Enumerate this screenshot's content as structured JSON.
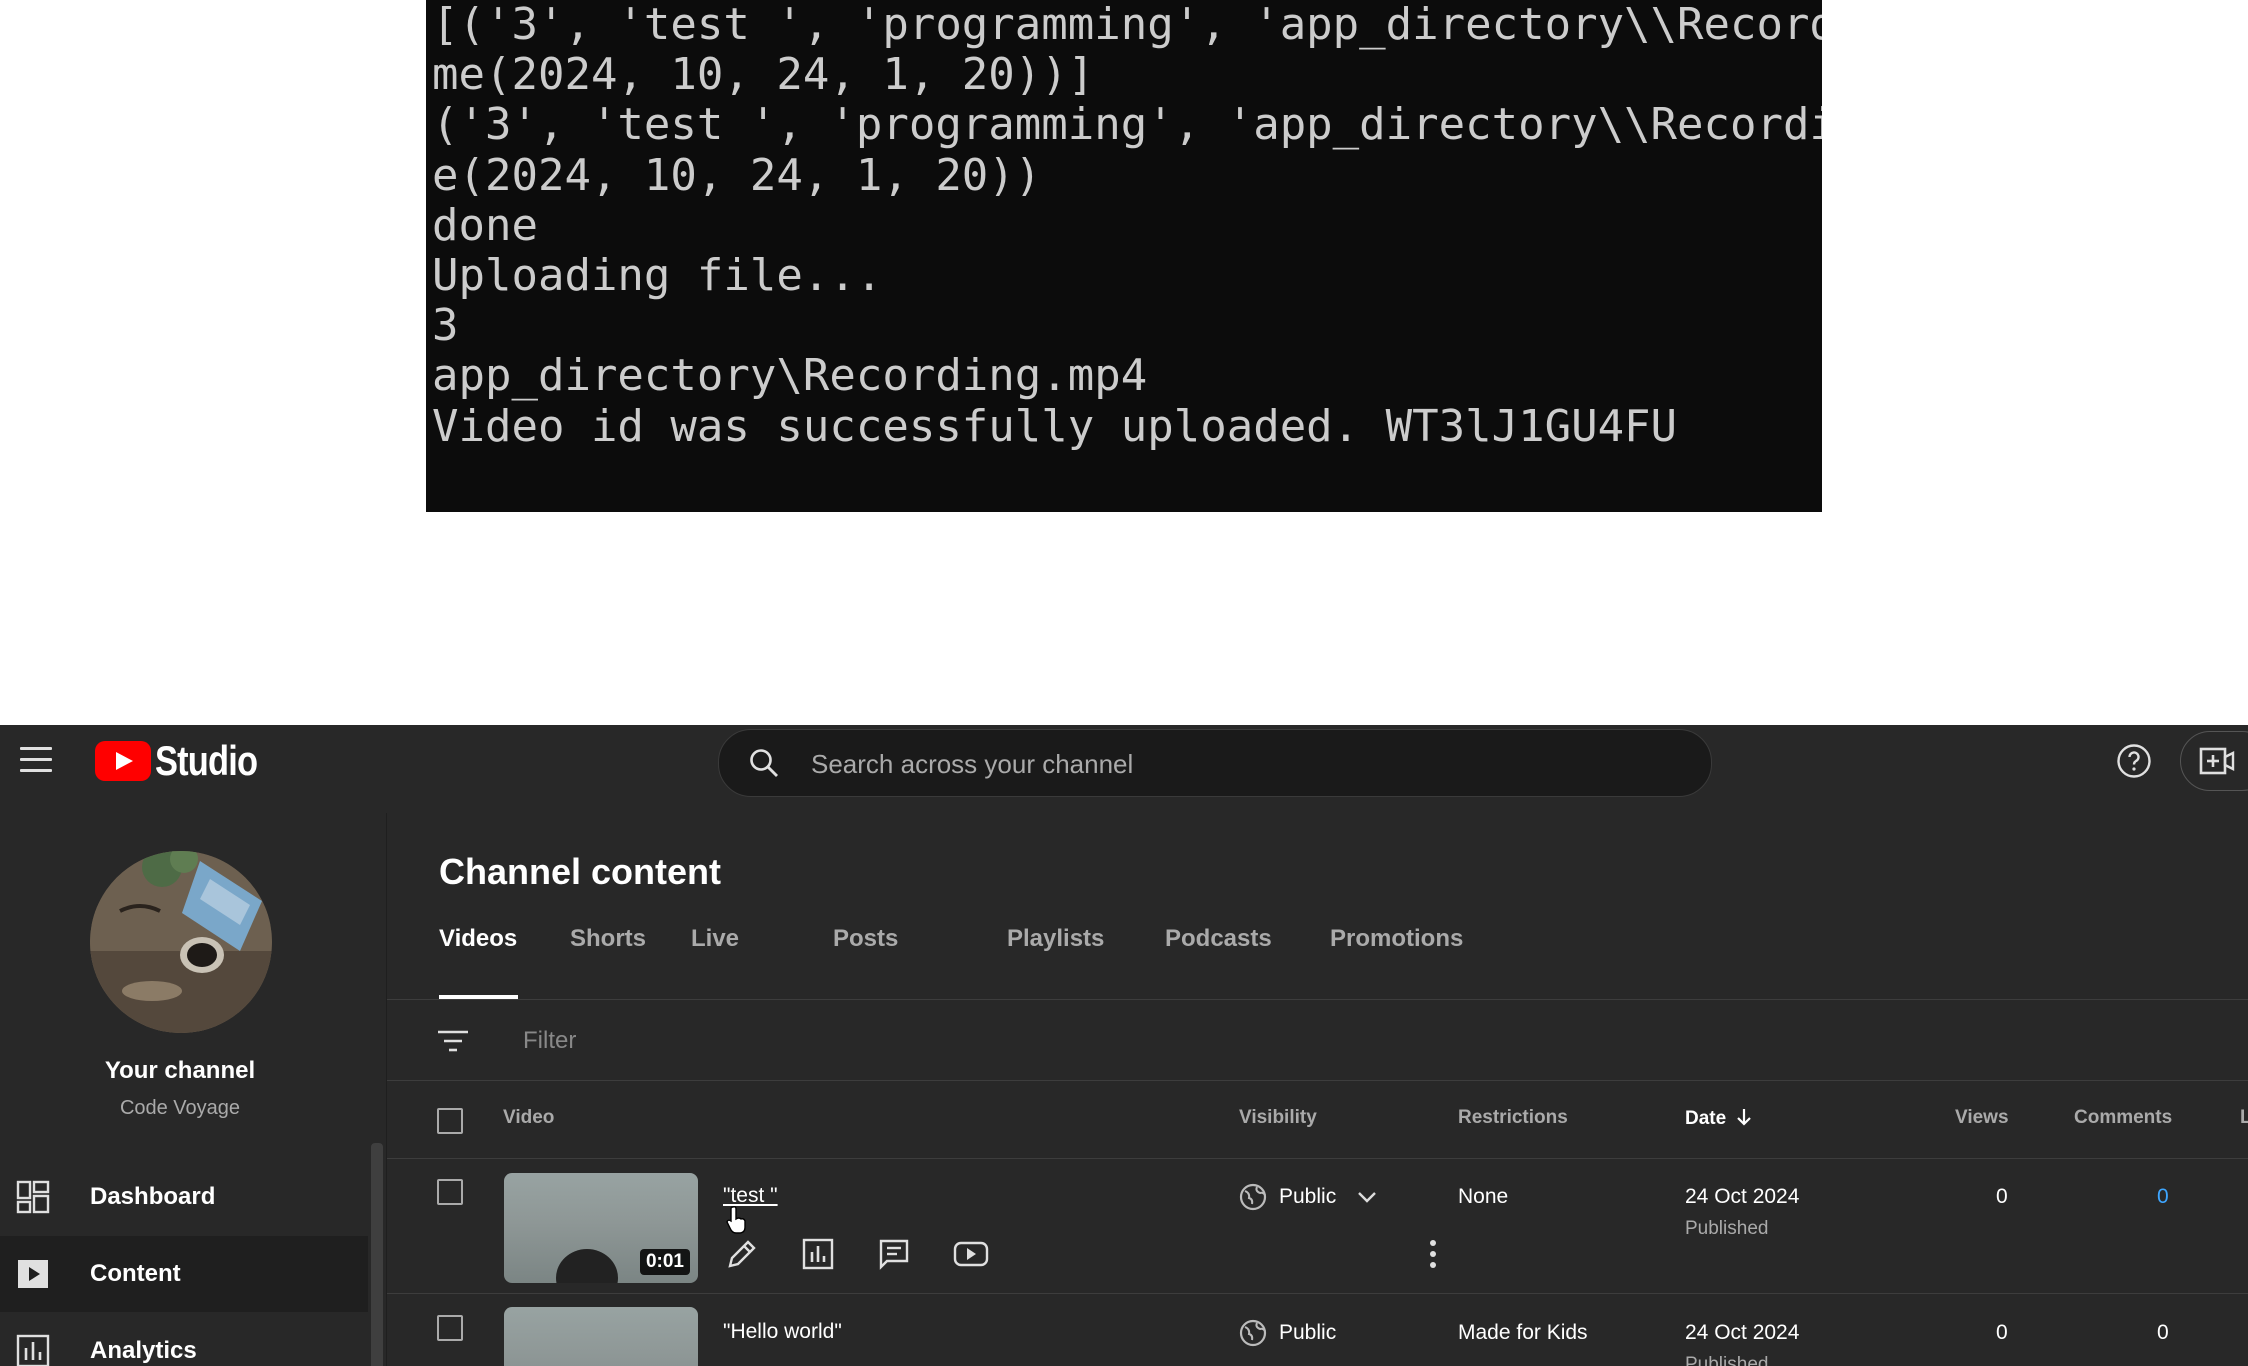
{
  "terminal": {
    "lines": [
      "[('3', 'test ', 'programming', 'app_directory\\\\Record",
      "me(2024, 10, 24, 1, 20))]",
      "('3', 'test ', 'programming', 'app_directory\\\\Recordi",
      "e(2024, 10, 24, 1, 20))",
      "done",
      "Uploading file...",
      "3",
      "app_directory\\Recording.mp4",
      "Video id was successfully uploaded. WT3lJ1GU4FU"
    ]
  },
  "header": {
    "logo_text": "Studio",
    "search_placeholder": "Search across your channel",
    "brand_color": "#ff0000"
  },
  "sidebar": {
    "channel_title": "Your channel",
    "channel_name": "Code Voyage",
    "items": [
      {
        "label": "Dashboard",
        "icon": "dashboard-icon"
      },
      {
        "label": "Content",
        "icon": "content-icon"
      },
      {
        "label": "Analytics",
        "icon": "analytics-icon"
      }
    ]
  },
  "main": {
    "title": "Channel content",
    "tabs": [
      "Videos",
      "Shorts",
      "Live",
      "Posts",
      "Playlists",
      "Podcasts",
      "Promotions"
    ],
    "filter_placeholder": "Filter",
    "columns": {
      "video": "Video",
      "visibility": "Visibility",
      "restrictions": "Restrictions",
      "date": "Date",
      "views": "Views",
      "comments": "Comments",
      "likes": "L"
    },
    "rows": [
      {
        "title": "\"test \"",
        "duration": "0:01",
        "visibility": "Public",
        "restrictions": "None",
        "date": "24 Oct 2024",
        "status": "Published",
        "views": "0",
        "comments": "0"
      },
      {
        "title": "\"Hello world\"",
        "visibility": "Public",
        "restrictions": "Made for Kids",
        "date": "24 Oct 2024",
        "status": "Published",
        "views": "0",
        "comments": "0"
      }
    ]
  }
}
